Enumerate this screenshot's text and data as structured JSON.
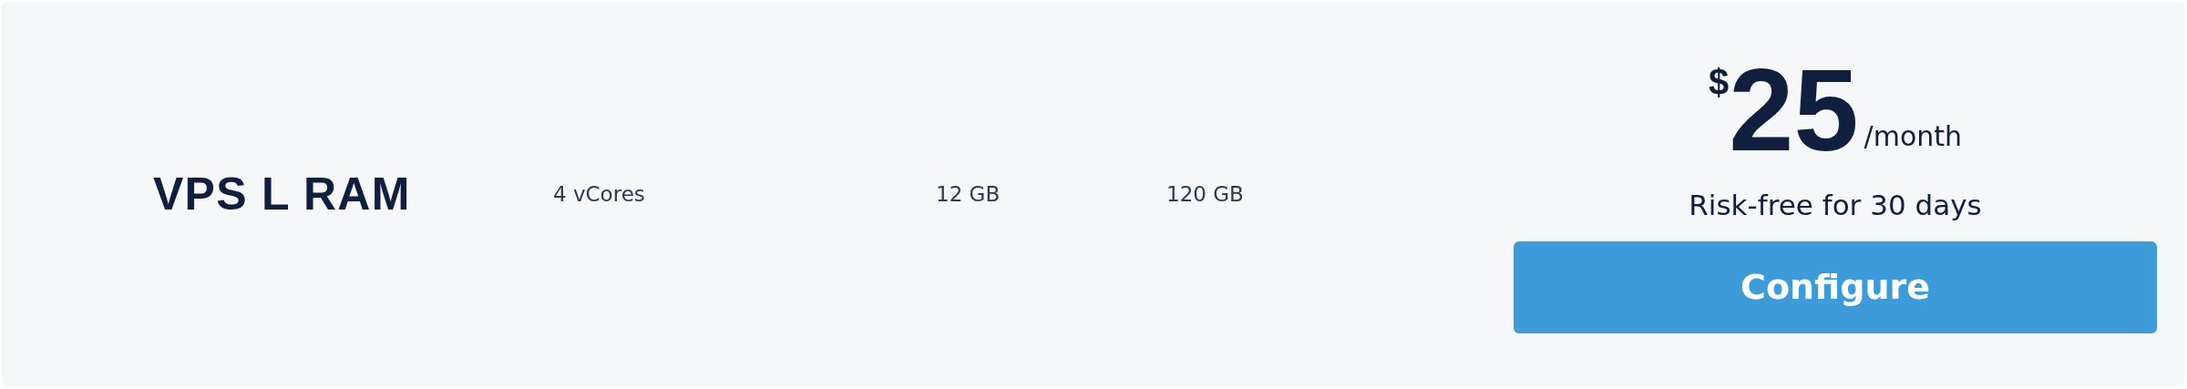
{
  "plan": {
    "name": "VPS L RAM",
    "specs": [
      "4 vCores",
      "12 GB",
      "120 GB"
    ]
  },
  "price": {
    "currency": "$",
    "amount": "25",
    "period": "/month",
    "note": "Risk-free for 30 days"
  },
  "button": {
    "label": "Configure"
  }
}
